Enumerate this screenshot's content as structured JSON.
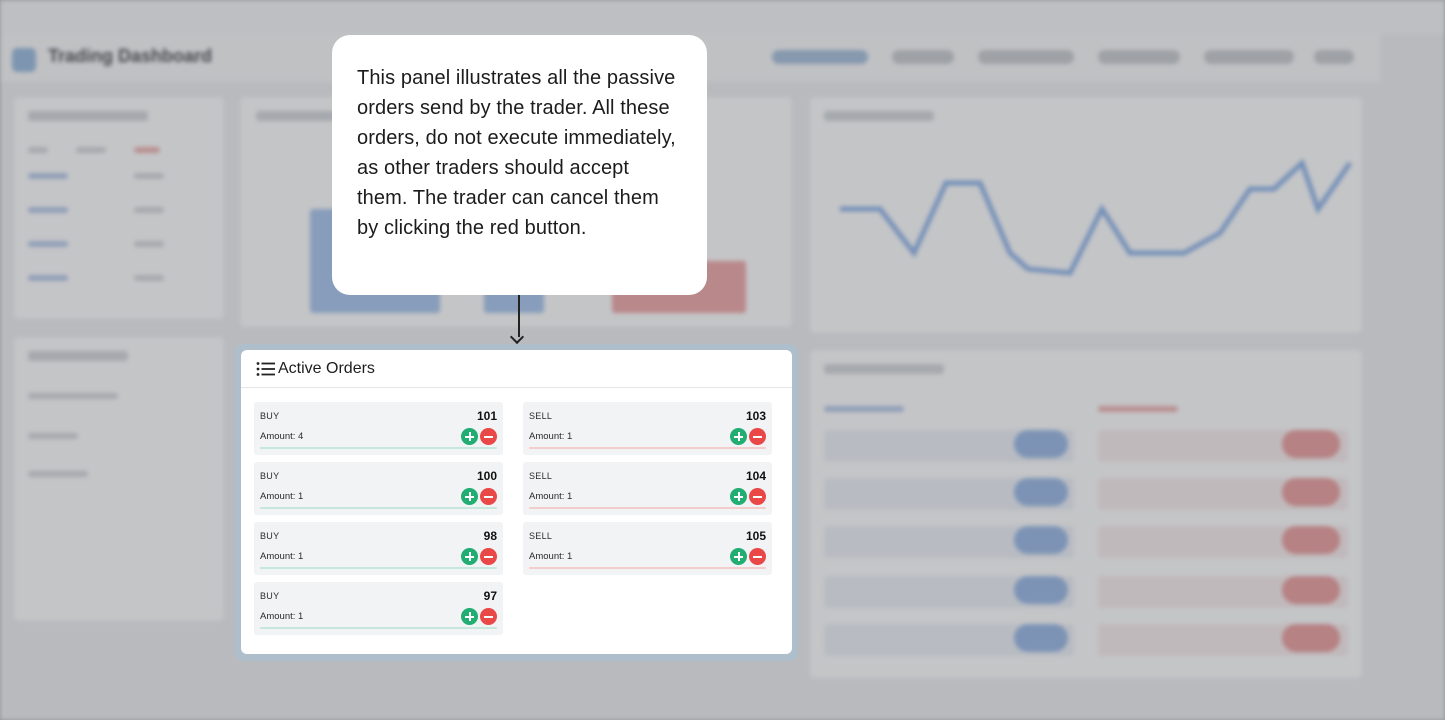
{
  "app": {
    "title": "Trading Dashboard"
  },
  "tooltip": {
    "text": "This panel illustrates all the passive orders send by the trader. All these orders, do not execute immediately, as other traders should accept them. The trader can cancel them by clicking the red button."
  },
  "active_orders": {
    "title": "Active Orders",
    "icon": "list-icon",
    "buy_orders": [
      {
        "side": "BUY",
        "price": "101",
        "amount": "Amount: 4"
      },
      {
        "side": "BUY",
        "price": "100",
        "amount": "Amount: 1"
      },
      {
        "side": "BUY",
        "price": "98",
        "amount": "Amount: 1"
      },
      {
        "side": "BUY",
        "price": "97",
        "amount": "Amount: 1"
      }
    ],
    "sell_orders": [
      {
        "side": "SELL",
        "price": "103",
        "amount": "Amount: 1"
      },
      {
        "side": "SELL",
        "price": "104",
        "amount": "Amount: 1"
      },
      {
        "side": "SELL",
        "price": "105",
        "amount": "Amount: 1"
      }
    ]
  },
  "colors": {
    "buy_accent": "#22ad73",
    "sell_accent": "#ea4747",
    "highlight_frame": "#aebfcb"
  }
}
